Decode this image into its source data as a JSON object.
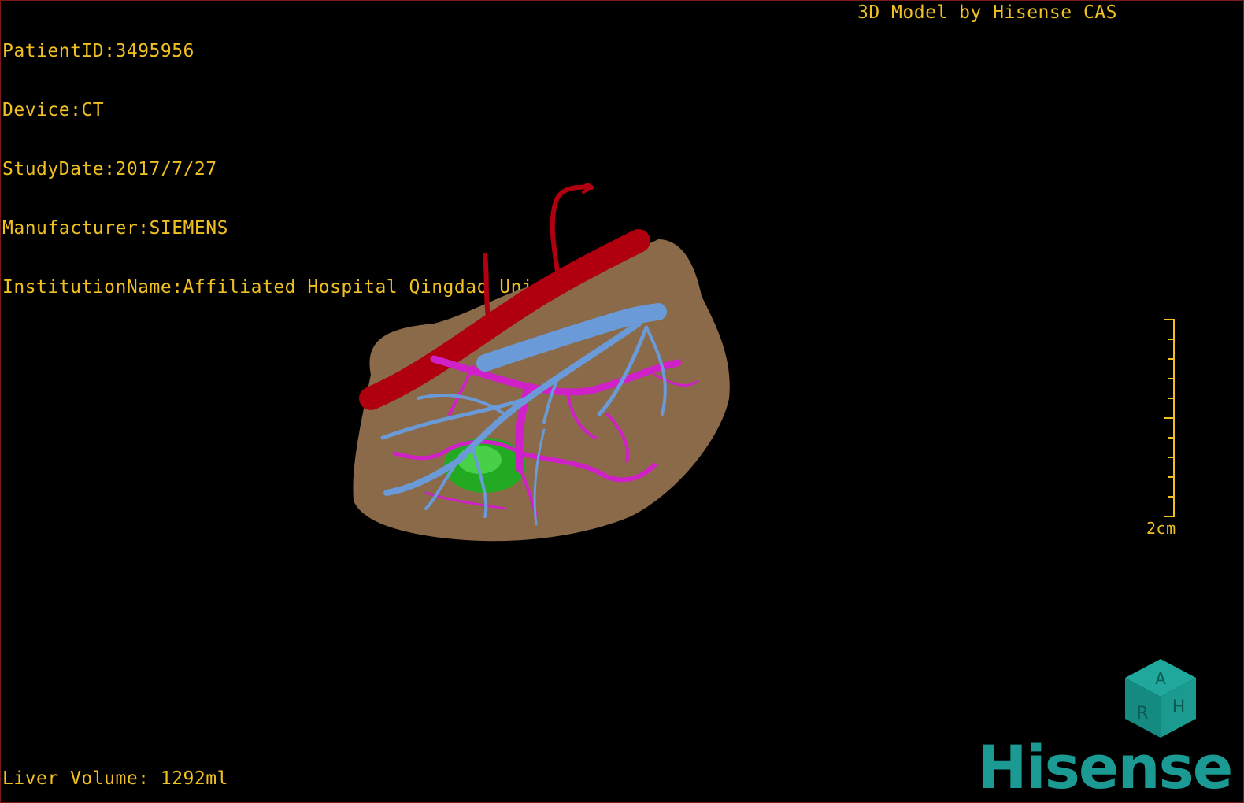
{
  "study_info": [
    "PatientID:3495956",
    "Device:CT",
    "StudyDate:2017/7/27",
    "Manufacturer:SIEMENS",
    "InstitutionName:Affiliated Hospital Qingdao University-C"
  ],
  "credit": "3D Model by Hisense CAS",
  "liver_volume": "Liver Volume: 1292ml",
  "scale_label": "2cm",
  "brand": "Hisense",
  "orientation_cube": {
    "top": "A",
    "front": "H",
    "side": "R"
  },
  "colors": {
    "text": "#f0c020",
    "liver": "#8a6a48",
    "artery": "#b00010",
    "hepatic_vein": "#6a9ad8",
    "portal_vein": "#d020c8",
    "lesion": "#20b020",
    "brand": "#1a9a92"
  },
  "icons": [
    "orientation-cube-icon",
    "hisense-logo"
  ]
}
